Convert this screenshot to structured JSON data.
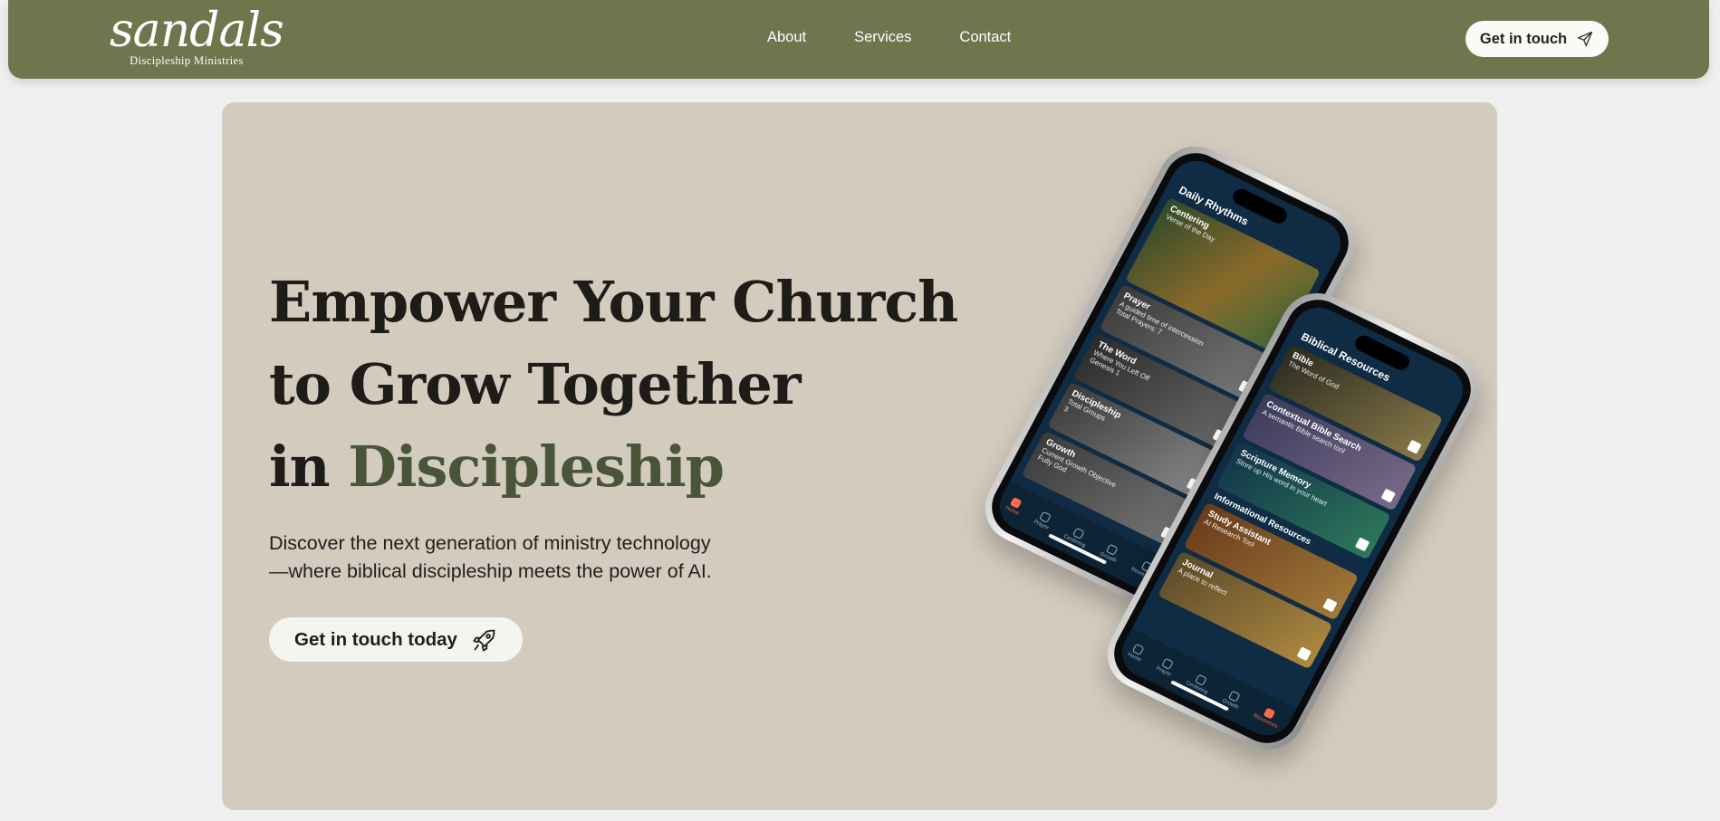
{
  "brand": {
    "name": "sandals",
    "subtitle": "Discipleship Ministries"
  },
  "nav": {
    "links": [
      {
        "label": "About"
      },
      {
        "label": "Services"
      },
      {
        "label": "Contact"
      }
    ],
    "cta_label": "Get in touch",
    "cta_icon": "paper-plane-icon"
  },
  "hero": {
    "headline_line1": "Empower Your Church",
    "headline_line2": "to Grow Together",
    "headline_line3_prefix": "in ",
    "headline_line3_accent": "Discipleship",
    "description_line1": "Discover the next generation of ministry technology",
    "description_line2": "—where biblical discipleship meets the power of AI.",
    "cta_label": "Get in touch today",
    "cta_icon": "rocket-icon"
  },
  "phone_left": {
    "title": "Daily Rhythms",
    "cards": [
      {
        "title": "Centering",
        "subtitle": "Verse of the Day",
        "color": "#8a6a2a"
      },
      {
        "title": "Prayer",
        "subtitle": "A guided time of intercession",
        "meta": "Total Prayers: 7",
        "color": "#4e4e4e"
      },
      {
        "title": "The Word",
        "subtitle": "Where You Left Off",
        "meta": "Genesis 1",
        "color": "#3b3b3b"
      },
      {
        "title": "Discipleship",
        "subtitle": "Total Groups",
        "meta": "3",
        "color": "#5a5a5a"
      },
      {
        "title": "Growth",
        "subtitle": "Current Growth Objective",
        "meta": "Fully God",
        "color": "#4a4a4a"
      }
    ],
    "tabs": [
      "Home",
      "Prayer",
      "Centering",
      "Growth",
      "Resources"
    ]
  },
  "phone_right": {
    "title": "Biblical Resources",
    "cards": [
      {
        "title": "Bible",
        "subtitle": "The Word of God",
        "color": "#6b5a3a"
      },
      {
        "title": "Contextual Bible Search",
        "subtitle": "A semantic Bible search tool",
        "color": "#4f4a68"
      },
      {
        "title": "Scripture Memory",
        "subtitle": "Store up His word in your heart",
        "color": "#1f5a4a"
      }
    ],
    "section2": "Informational Resources",
    "cards2": [
      {
        "title": "Study Assistant",
        "subtitle": "AI Research Tool",
        "color": "#7a5a2a"
      },
      {
        "title": "Journal",
        "subtitle": "A place to reflect",
        "color": "#8a6a30"
      }
    ],
    "tabs": [
      "Home",
      "Prayer",
      "Centering",
      "Growth",
      "Resources"
    ]
  },
  "colors": {
    "nav_bg": "#6e764e",
    "hero_bg": "#d3cbbe",
    "accent": "#4a5438",
    "page_bg": "#efefef"
  }
}
